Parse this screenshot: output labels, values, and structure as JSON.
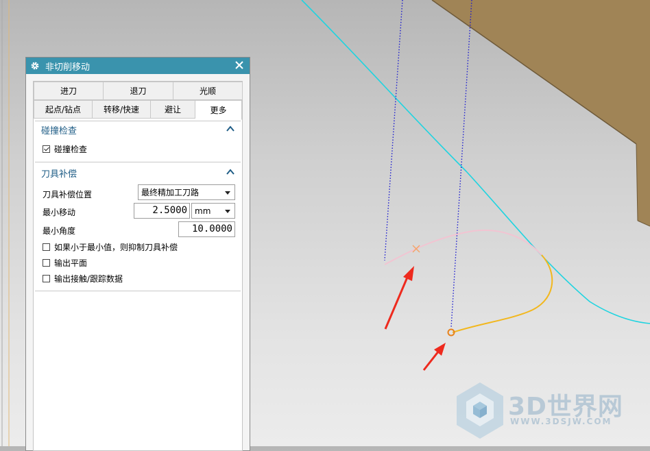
{
  "dialog": {
    "title": "非切削移动",
    "tabs_row1": [
      "进刀",
      "退刀",
      "光顺"
    ],
    "tabs_row2": [
      "起点/钻点",
      "转移/快速",
      "避让",
      "更多"
    ],
    "active_tab": "更多",
    "collision": {
      "header": "碰撞检查",
      "checkbox_label": "碰撞检查",
      "checked": true
    },
    "tool_comp": {
      "header": "刀具补偿",
      "position_label": "刀具补偿位置",
      "position_value": "最终精加工刀路",
      "min_move_label": "最小移动",
      "min_move_value": "2.5000",
      "min_move_unit": "mm",
      "min_angle_label": "最小角度",
      "min_angle_value": "10.0000",
      "suppress_label": "如果小于最小值，则抑制刀具补偿",
      "suppress_checked": false,
      "output_plane_label": "输出平面",
      "output_plane_checked": false,
      "output_contact_label": "输出接触/跟踪数据",
      "output_contact_checked": false
    }
  },
  "watermark": {
    "brand": "3D世界网",
    "url": "WWW.3DSJW.COM"
  },
  "colors": {
    "title_bar": "#3a93ad",
    "section_header": "#1f5d86",
    "part_surface": "#a08456",
    "cyan_curve": "#1fd4e0",
    "toolpath_pink": "#f2c4d2",
    "toolpath_orange": "#f2b71d",
    "annotation_arrow": "#ee2a1e",
    "dotted_path": "#1a1ad0"
  }
}
